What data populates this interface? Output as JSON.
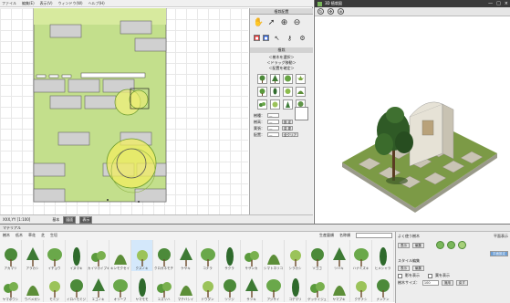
{
  "plan_window": {
    "menu": [
      "ファイル",
      "編集(E)",
      "表示(V)",
      "ウィンドウ(W)",
      "ヘルプ(H)"
    ],
    "status": {
      "coord": "XXX,YY [1:100]",
      "mode_label": "基本",
      "btn1": "図面",
      "btn2": "表示"
    }
  },
  "placement_panel": {
    "title": "植栽配置",
    "section_title": "植栽",
    "hint_lines": [
      "＜樹木を選択＞",
      "＜ドラッグ移動＞",
      "＜配置を確定＞"
    ],
    "props": [
      {
        "label": "樹種：",
        "value": "—",
        "button": ""
      },
      {
        "label": "樹高：",
        "value": "—",
        "button": "設 定"
      },
      {
        "label": "葉張：",
        "value": "—",
        "button": "変 更"
      },
      {
        "label": "配置：",
        "value": "—",
        "button": "全クリア"
      }
    ],
    "colors": {
      "red": "#e03030",
      "blue": "#2f5fd0"
    }
  },
  "view3d": {
    "title": "3D 植栽図",
    "controls": [
      "—",
      "□",
      "×"
    ]
  },
  "library": {
    "title": "マテリアル",
    "tabs": [
      "樹木",
      "低木",
      "草花",
      "芝",
      "生垣",
      "生産量順",
      "名称順"
    ],
    "search_value": "",
    "row1": [
      "アカマツ",
      "アラカシ",
      "イチョウ",
      "イヌマキ",
      "カイヅカイブキ",
      "キンモクセイ",
      "クスノキ",
      "クロガネモチ",
      "ケヤキ",
      "コナラ",
      "サクラ",
      "サザンカ",
      "シマトネリコ",
      "シラカシ",
      "ソヨゴ",
      "ツバキ",
      "ハナミズキ",
      "ヒメシャラ"
    ],
    "row2": [
      "ヤマボウシ",
      "ウバメガシ",
      "モミジ",
      "イロハモミジ",
      "エゴノキ",
      "オリーブ",
      "ヤマモモ",
      "ユズリハ",
      "マテバシイ",
      "ドウダン",
      "ツツジ",
      "サツキ",
      "アジサイ",
      "コデマリ",
      "ゲッケイジュ",
      "ヤマブキ",
      "クチナシ",
      "ナンテン"
    ],
    "selected_index": 6,
    "side": {
      "edit_title": "よく使う樹木",
      "edit_buttons": [
        "表示",
        "編集"
      ],
      "radio_title": "平面表示",
      "radio_btn": "平面設定",
      "style_title": "スタイル編集",
      "style_buttons": [
        "表示",
        "編集"
      ],
      "check1": "影を表示",
      "check2": "葉を表示",
      "scale_label": "樹木サイズ：",
      "scale_value": "100",
      "scale_buttons": [
        "適用",
        "戻す"
      ]
    }
  }
}
